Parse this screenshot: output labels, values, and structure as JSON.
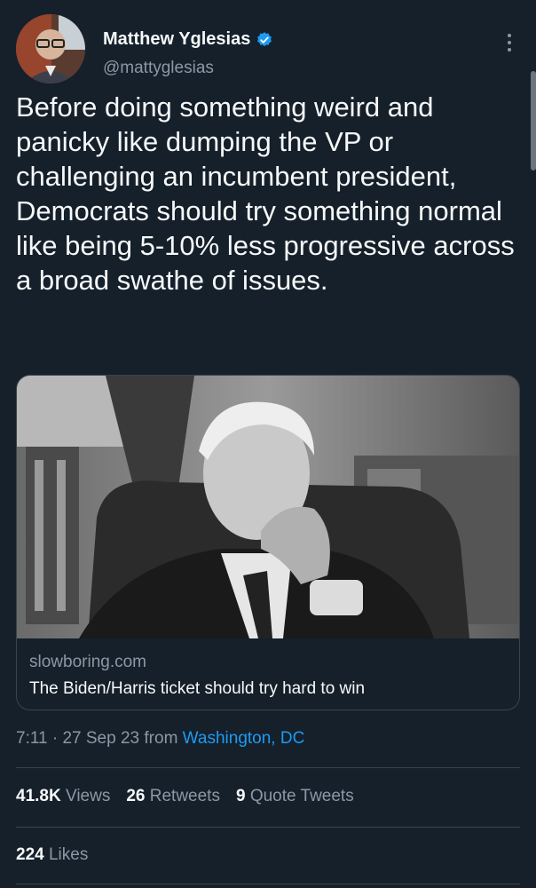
{
  "tweet": {
    "author_name": "Matthew Yglesias",
    "author_handle": "@mattyglesias",
    "text": "Before doing something weird and panicky like dumping the VP or challenging an incumbent president, Democrats should try something normal like being 5-10% less progressive across a broad swathe of issues."
  },
  "card": {
    "domain": "slowboring.com",
    "title": "The Biden/Harris ticket should try hard to win"
  },
  "meta": {
    "time": "7:11",
    "separator": "·",
    "date": "27 Sep 23",
    "from": "from",
    "location": "Washington, DC"
  },
  "stats": {
    "views_count": "41.8K",
    "views_label": "Views",
    "retweets_count": "26",
    "retweets_label": "Retweets",
    "quotes_count": "9",
    "quotes_label": "Quote Tweets",
    "likes_count": "224",
    "likes_label": "Likes"
  },
  "colors": {
    "background": "#15202b",
    "link": "#1d9bf0",
    "secondary_text": "#8b98a5",
    "divider": "#38444d",
    "verified": "#1d9bf0"
  },
  "icons": [
    "verified-badge-icon",
    "more-options-icon"
  ]
}
